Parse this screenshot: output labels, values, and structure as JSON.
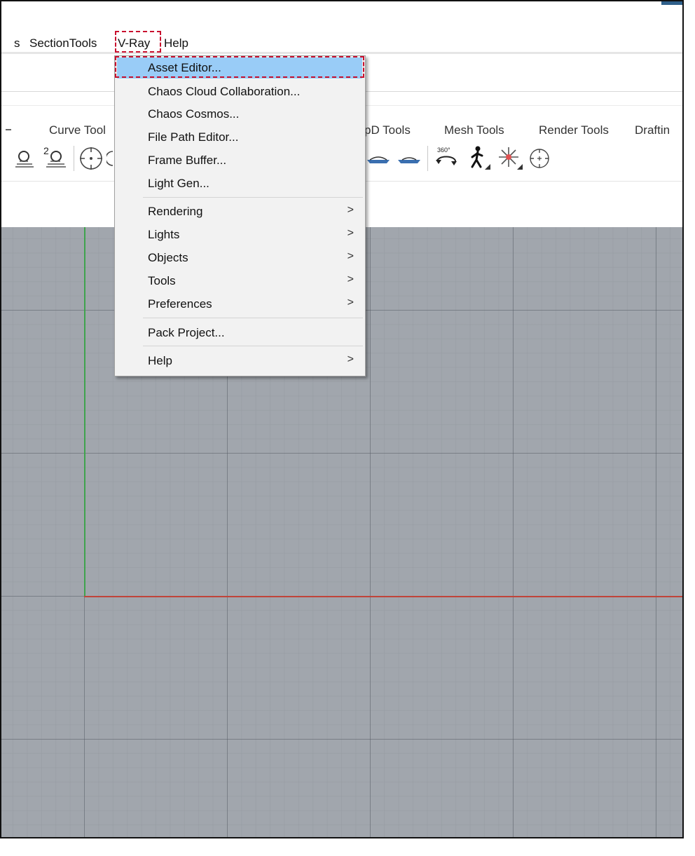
{
  "menubar": {
    "items": [
      {
        "label": "s"
      },
      {
        "label": "SectionTools"
      },
      {
        "label": "V-Ray"
      },
      {
        "label": "Help"
      }
    ]
  },
  "tabs": [
    {
      "label": "Curve Tool"
    },
    {
      "label": "pD Tools"
    },
    {
      "label": "Mesh Tools"
    },
    {
      "label": "Render Tools"
    },
    {
      "label": "Draftin"
    }
  ],
  "toolbar": {
    "icons": [
      "zoom-icon",
      "zoom-2-icon",
      "target-icon",
      "vehicle-icon",
      "vehicle-2-icon",
      "rotate-360-icon",
      "walk-icon",
      "sun-icon",
      "target-2-icon"
    ],
    "rotate_label": "360°"
  },
  "vray_menu": {
    "items": [
      {
        "label": "Asset Editor...",
        "submenu": false,
        "highlighted": true
      },
      {
        "label": "Chaos Cloud Collaboration...",
        "submenu": false
      },
      {
        "label": "Chaos Cosmos...",
        "submenu": false
      },
      {
        "label": "File Path Editor...",
        "submenu": false
      },
      {
        "label": "Frame Buffer...",
        "submenu": false
      },
      {
        "label": "Light Gen...",
        "submenu": false
      },
      {
        "label": "Rendering",
        "submenu": true
      },
      {
        "label": "Lights",
        "submenu": true
      },
      {
        "label": "Objects",
        "submenu": true
      },
      {
        "label": "Tools",
        "submenu": true
      },
      {
        "label": "Preferences",
        "submenu": true
      },
      {
        "label": "Pack Project...",
        "submenu": false
      },
      {
        "label": "Help",
        "submenu": true
      }
    ],
    "submenu_arrow": ">"
  },
  "colors": {
    "highlight": "#99ccf7",
    "dash_annotation": "#c8102e",
    "viewport_grid": "#a1a6ad",
    "axis_x": "#c0443a",
    "axis_y": "#3fa34d"
  }
}
